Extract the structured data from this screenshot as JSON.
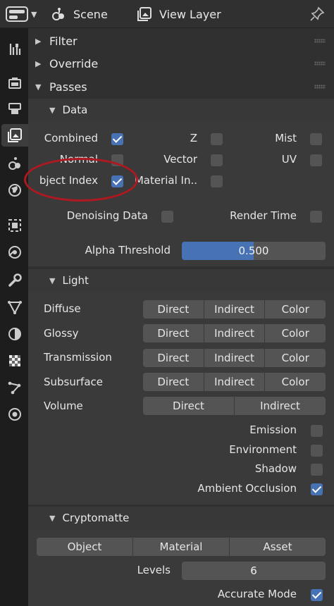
{
  "header": {
    "scene_label": "Scene",
    "view_layer_label": "View Layer"
  },
  "tabs": [
    {
      "name": "tool-icon",
      "active": false
    },
    {
      "name": "render-icon",
      "active": false
    },
    {
      "name": "output-icon",
      "active": false
    },
    {
      "name": "view-layer-icon",
      "active": true
    },
    {
      "name": "scene-icon",
      "active": false
    },
    {
      "name": "world-icon",
      "active": false
    },
    {
      "name": "object-icon",
      "active": false
    },
    {
      "name": "modifiers-icon",
      "active": false
    },
    {
      "name": "wrench-icon",
      "active": false
    },
    {
      "name": "particles-icon",
      "active": false
    },
    {
      "name": "physics-icon",
      "active": false
    },
    {
      "name": "constraints-icon",
      "active": false
    },
    {
      "name": "data-icon",
      "active": false
    },
    {
      "name": "material-icon",
      "active": false
    }
  ],
  "panels": {
    "filter": "Filter",
    "override": "Override",
    "passes": "Passes"
  },
  "data": {
    "title": "Data",
    "combined": {
      "label": "Combined",
      "checked": true
    },
    "z": {
      "label": "Z",
      "checked": false
    },
    "mist": {
      "label": "Mist",
      "checked": false
    },
    "normal": {
      "label": "Normal",
      "checked": false
    },
    "vector": {
      "label": "Vector",
      "checked": false
    },
    "uv": {
      "label": "UV",
      "checked": false
    },
    "object_index": {
      "label": "bject Index",
      "checked": true
    },
    "material_index": {
      "label": "Material In..",
      "checked": false
    },
    "denoising": {
      "label": "Denoising Data",
      "checked": false
    },
    "render_time": {
      "label": "Render Time",
      "checked": false
    },
    "alpha_threshold": {
      "label": "Alpha Threshold",
      "value": "0.500",
      "fraction": 0.5
    }
  },
  "light": {
    "title": "Light",
    "direct": "Direct",
    "indirect": "Indirect",
    "color": "Color",
    "rows": {
      "diffuse": "Diffuse",
      "glossy": "Glossy",
      "transmission": "Transmission",
      "subsurface": "Subsurface",
      "volume": "Volume"
    },
    "emission": {
      "label": "Emission",
      "checked": false
    },
    "environment": {
      "label": "Environment",
      "checked": false
    },
    "shadow": {
      "label": "Shadow",
      "checked": false
    },
    "ao": {
      "label": "Ambient Occlusion",
      "checked": true
    }
  },
  "crypto": {
    "title": "Cryptomatte",
    "object": "Object",
    "material": "Material",
    "asset": "Asset",
    "levels_label": "Levels",
    "levels_value": "6",
    "accurate": {
      "label": "Accurate Mode",
      "checked": true
    }
  },
  "colors": {
    "accent": "#4772b3",
    "annotation": "#b01820"
  }
}
